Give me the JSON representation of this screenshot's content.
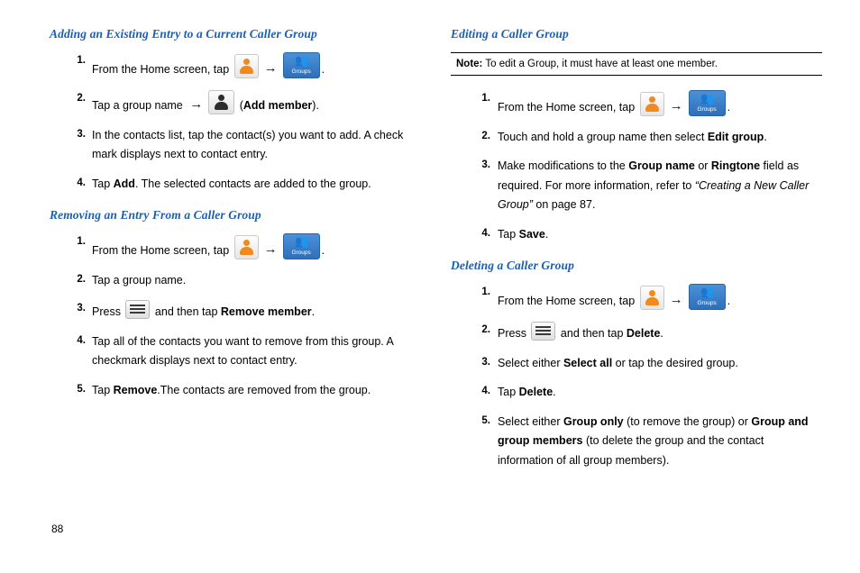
{
  "page": {
    "number": "88"
  },
  "icons": {
    "contact": "contact-icon",
    "add_member": "add-member-icon",
    "groups": "groups-icon",
    "groups_label": "Groups",
    "menu": "menu-key-icon",
    "arrow": "→"
  },
  "left_column": {
    "sections": [
      {
        "heading": "Adding an Existing Entry to a Current Caller Group",
        "steps": [
          {
            "num": "1.",
            "parts": [
              {
                "t": "text",
                "v": "From the Home screen, tap "
              },
              {
                "t": "icon",
                "v": "contact"
              },
              {
                "t": "arrow"
              },
              {
                "t": "icon",
                "v": "groups"
              },
              {
                "t": "text",
                "v": "."
              }
            ]
          },
          {
            "num": "2.",
            "parts": [
              {
                "t": "text",
                "v": "Tap a group name "
              },
              {
                "t": "arrow"
              },
              {
                "t": "icon",
                "v": "add_member"
              },
              {
                "t": "text",
                "v": " ("
              },
              {
                "t": "bold",
                "v": "Add member"
              },
              {
                "t": "text",
                "v": ")."
              }
            ]
          },
          {
            "num": "3.",
            "parts": [
              {
                "t": "text",
                "v": "In the contacts list, tap the contact(s) you want to add. A check mark displays next to contact entry."
              }
            ]
          },
          {
            "num": "4.",
            "parts": [
              {
                "t": "text",
                "v": "Tap "
              },
              {
                "t": "bold",
                "v": "Add"
              },
              {
                "t": "text",
                "v": ". The selected contacts are added to the group."
              }
            ]
          }
        ]
      },
      {
        "heading": "Removing an Entry From a Caller Group",
        "steps": [
          {
            "num": "1.",
            "parts": [
              {
                "t": "text",
                "v": "From the Home screen, tap "
              },
              {
                "t": "icon",
                "v": "contact"
              },
              {
                "t": "arrow"
              },
              {
                "t": "icon",
                "v": "groups"
              },
              {
                "t": "text",
                "v": "."
              }
            ]
          },
          {
            "num": "2.",
            "parts": [
              {
                "t": "text",
                "v": "Tap a group name."
              }
            ]
          },
          {
            "num": "3.",
            "parts": [
              {
                "t": "text",
                "v": "Press "
              },
              {
                "t": "icon",
                "v": "menu"
              },
              {
                "t": "text",
                "v": " and then tap "
              },
              {
                "t": "bold",
                "v": "Remove member"
              },
              {
                "t": "text",
                "v": "."
              }
            ]
          },
          {
            "num": "4.",
            "parts": [
              {
                "t": "text",
                "v": "Tap all of the contacts you want to remove from this group. A checkmark displays next to contact entry."
              }
            ]
          },
          {
            "num": "5.",
            "parts": [
              {
                "t": "text",
                "v": "Tap "
              },
              {
                "t": "bold",
                "v": "Remove"
              },
              {
                "t": "text",
                "v": ".The contacts are removed from the group."
              }
            ]
          }
        ]
      }
    ]
  },
  "right_column": {
    "sections": [
      {
        "heading": "Editing a Caller Group",
        "note": {
          "label": "Note:",
          "text": " To edit a Group, it must have at least one member."
        },
        "steps": [
          {
            "num": "1.",
            "parts": [
              {
                "t": "text",
                "v": "From the Home screen, tap "
              },
              {
                "t": "icon",
                "v": "contact"
              },
              {
                "t": "arrow"
              },
              {
                "t": "icon",
                "v": "groups"
              },
              {
                "t": "text",
                "v": "."
              }
            ]
          },
          {
            "num": "2.",
            "parts": [
              {
                "t": "text",
                "v": "Touch and hold a group name then select "
              },
              {
                "t": "bold",
                "v": "Edit group"
              },
              {
                "t": "text",
                "v": "."
              }
            ]
          },
          {
            "num": "3.",
            "parts": [
              {
                "t": "text",
                "v": "Make modifications to the "
              },
              {
                "t": "bold",
                "v": "Group name"
              },
              {
                "t": "text",
                "v": " or "
              },
              {
                "t": "bold",
                "v": "Ringtone"
              },
              {
                "t": "text",
                "v": " field as required. For more information, refer to "
              },
              {
                "t": "italic",
                "v": "“Creating a New Caller Group”"
              },
              {
                "t": "text",
                "v": "  on page 87."
              }
            ]
          },
          {
            "num": "4.",
            "parts": [
              {
                "t": "text",
                "v": "Tap "
              },
              {
                "t": "bold",
                "v": "Save"
              },
              {
                "t": "text",
                "v": "."
              }
            ]
          }
        ]
      },
      {
        "heading": "Deleting a Caller Group",
        "steps": [
          {
            "num": "1.",
            "parts": [
              {
                "t": "text",
                "v": "From the Home screen, tap "
              },
              {
                "t": "icon",
                "v": "contact"
              },
              {
                "t": "arrow"
              },
              {
                "t": "icon",
                "v": "groups"
              },
              {
                "t": "text",
                "v": "."
              }
            ]
          },
          {
            "num": "2.",
            "parts": [
              {
                "t": "text",
                "v": "Press "
              },
              {
                "t": "icon",
                "v": "menu"
              },
              {
                "t": "text",
                "v": " and then tap "
              },
              {
                "t": "bold",
                "v": "Delete"
              },
              {
                "t": "text",
                "v": "."
              }
            ]
          },
          {
            "num": "3.",
            "parts": [
              {
                "t": "text",
                "v": "Select either "
              },
              {
                "t": "bold",
                "v": "Select all"
              },
              {
                "t": "text",
                "v": " or tap the desired group."
              }
            ]
          },
          {
            "num": "4.",
            "parts": [
              {
                "t": "text",
                "v": "Tap "
              },
              {
                "t": "bold",
                "v": "Delete"
              },
              {
                "t": "text",
                "v": "."
              }
            ]
          },
          {
            "num": "5.",
            "parts": [
              {
                "t": "text",
                "v": "Select either "
              },
              {
                "t": "bold",
                "v": "Group only"
              },
              {
                "t": "text",
                "v": " (to remove the group) or "
              },
              {
                "t": "bold",
                "v": "Group and group members"
              },
              {
                "t": "text",
                "v": " (to delete the group and the contact information of all group members)."
              }
            ]
          }
        ]
      }
    ]
  }
}
